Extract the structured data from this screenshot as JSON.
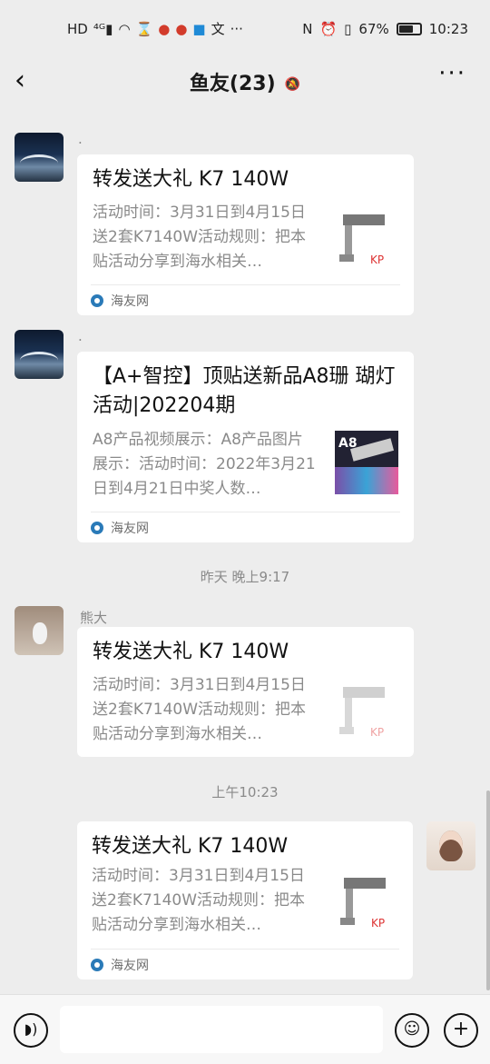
{
  "status_bar": {
    "left_icons": [
      "hd-icon",
      "4g-signal-icon",
      "wifi-icon",
      "hourglass-icon",
      "weibo-icon",
      "weibo-icon",
      "truck-app-icon",
      "translate-icon",
      "more-dots"
    ],
    "nfc": "N",
    "battery_percent": "67%",
    "battery_level": 0.67,
    "time": "10:23"
  },
  "header": {
    "title": "鱼友(23)",
    "back_icon": "chevron-left-icon",
    "mute_icon": "bell-off-icon",
    "more_icon": "more-icon"
  },
  "messages": [
    {
      "sender": ".",
      "card": {
        "title": "转发送大礼 K7 140W",
        "desc": "活动时间：3月31日到4月15日送2套K7140W活动规则：把本贴活动分享到海水相关…",
        "source": "海友网"
      }
    },
    {
      "sender": ".",
      "card": {
        "title": "【A+智控】顶贴送新品A8珊 瑚灯活动|202204期",
        "desc": "A8产品视频展示：A8产品图片展示：活动时间：2022年3月21日到4月21日中奖人数…",
        "source": "海友网",
        "thumb_label": "A8"
      }
    },
    {
      "timestamp": "昨天 晚上9:17"
    },
    {
      "sender": "熊大",
      "card": {
        "title": "转发送大礼 K7 140W",
        "desc": "活动时间：3月31日到4月15日送2套K7140W活动规则：把本贴活动分享到海水相关…"
      }
    },
    {
      "timestamp": "上午10:23"
    },
    {
      "card": {
        "title": "转发送大礼 K7 140W",
        "desc": "活动时间：3月31日到4月15日送2套K7140W活动规则：把本贴活动分享到海水相关…",
        "source": "海友网"
      }
    }
  ],
  "bottom_bar": {
    "voice_icon": "voice-icon",
    "emoji_icon": "emoji-icon",
    "plus_icon": "plus-icon"
  }
}
